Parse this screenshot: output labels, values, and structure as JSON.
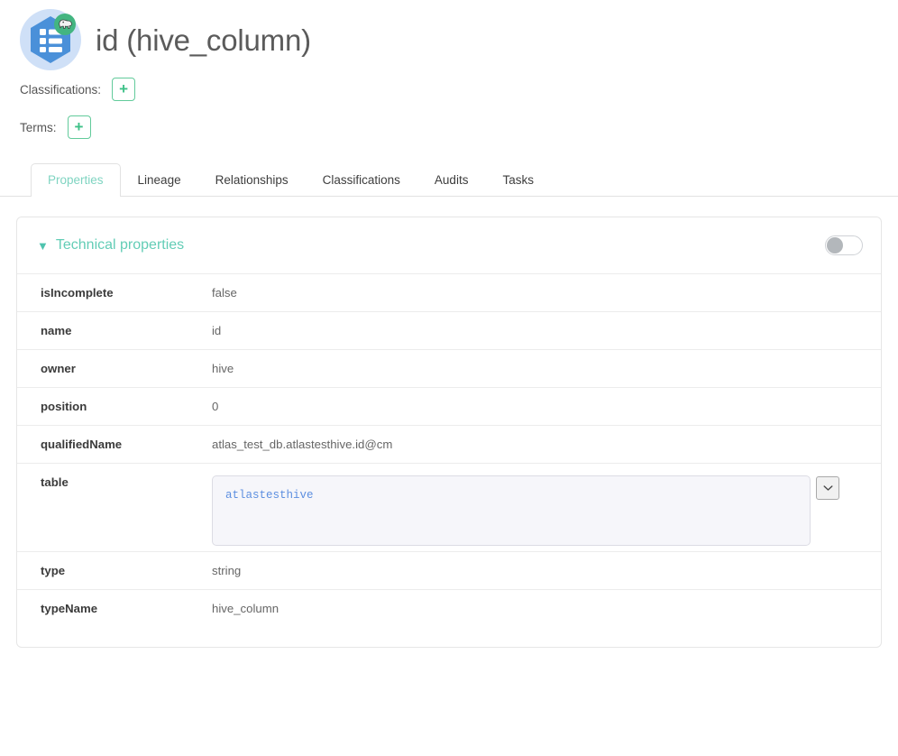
{
  "entity": {
    "title": "id (hive_column)",
    "icon_name": "hive-column-hexagon-icon",
    "badge_icon_name": "hive-elephant-badge-icon"
  },
  "meta": {
    "classifications_label": "Classifications:",
    "classifications_add_label": "+",
    "terms_label": "Terms:",
    "terms_add_label": "+"
  },
  "tabs": [
    {
      "label": "Properties",
      "active": true
    },
    {
      "label": "Lineage",
      "active": false
    },
    {
      "label": "Relationships",
      "active": false
    },
    {
      "label": "Classifications",
      "active": false
    },
    {
      "label": "Audits",
      "active": false
    },
    {
      "label": "Tasks",
      "active": false
    }
  ],
  "panel": {
    "title": "Technical properties",
    "collapse_icon": "⌄",
    "toggle_state": "off"
  },
  "properties": [
    {
      "key": "isIncomplete",
      "value": "false",
      "kind": "text"
    },
    {
      "key": "name",
      "value": "id",
      "kind": "text"
    },
    {
      "key": "owner",
      "value": "hive",
      "kind": "text"
    },
    {
      "key": "position",
      "value": "0",
      "kind": "text"
    },
    {
      "key": "qualifiedName",
      "value": "atlas_test_db.atlastesthive.id@cm",
      "kind": "text"
    },
    {
      "key": "table",
      "value": "atlastesthive",
      "kind": "reference"
    },
    {
      "key": "type",
      "value": "string",
      "kind": "text"
    },
    {
      "key": "typeName",
      "value": "hive_column",
      "kind": "text"
    }
  ],
  "colors": {
    "accent_teal": "#63cdb6",
    "add_button_green": "#3ec188",
    "link_blue": "#5d8fe0",
    "avatar_bg": "#cfe0f7",
    "hex_blue": "#4a90d9",
    "badge_green": "#43b581"
  }
}
